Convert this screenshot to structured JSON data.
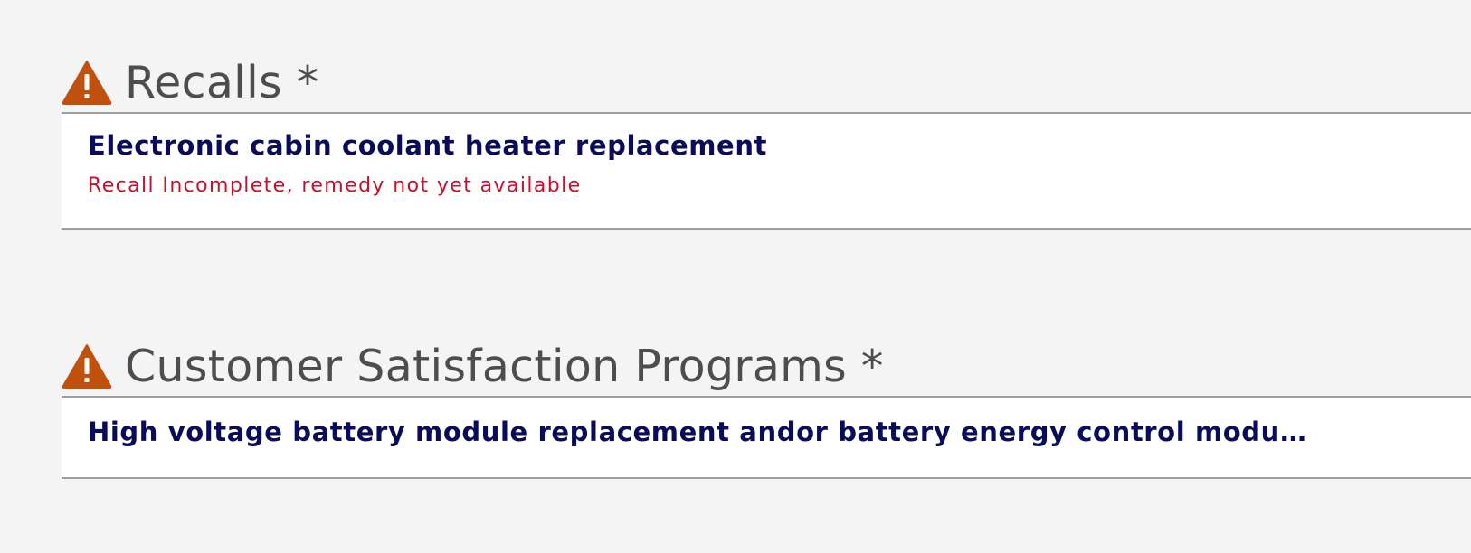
{
  "colors": {
    "background": "#f4f4f4",
    "card": "#ffffff",
    "heading": "#4d4d4d",
    "item_title": "#0b0b5c",
    "status_error": "#c8102e",
    "warning_icon": "#c0500e",
    "divider": "#9e9e9e"
  },
  "recalls": {
    "icon": "warning-triangle-icon",
    "title": "Recalls *",
    "items": [
      {
        "title": "Electronic cabin coolant heater replacement",
        "status": "Recall Incomplete, remedy not yet available"
      }
    ]
  },
  "csp": {
    "icon": "warning-triangle-icon",
    "title": "Customer Satisfaction Programs *",
    "items": [
      {
        "title": "High voltage battery module replacement andor battery energy control modu…"
      }
    ]
  }
}
